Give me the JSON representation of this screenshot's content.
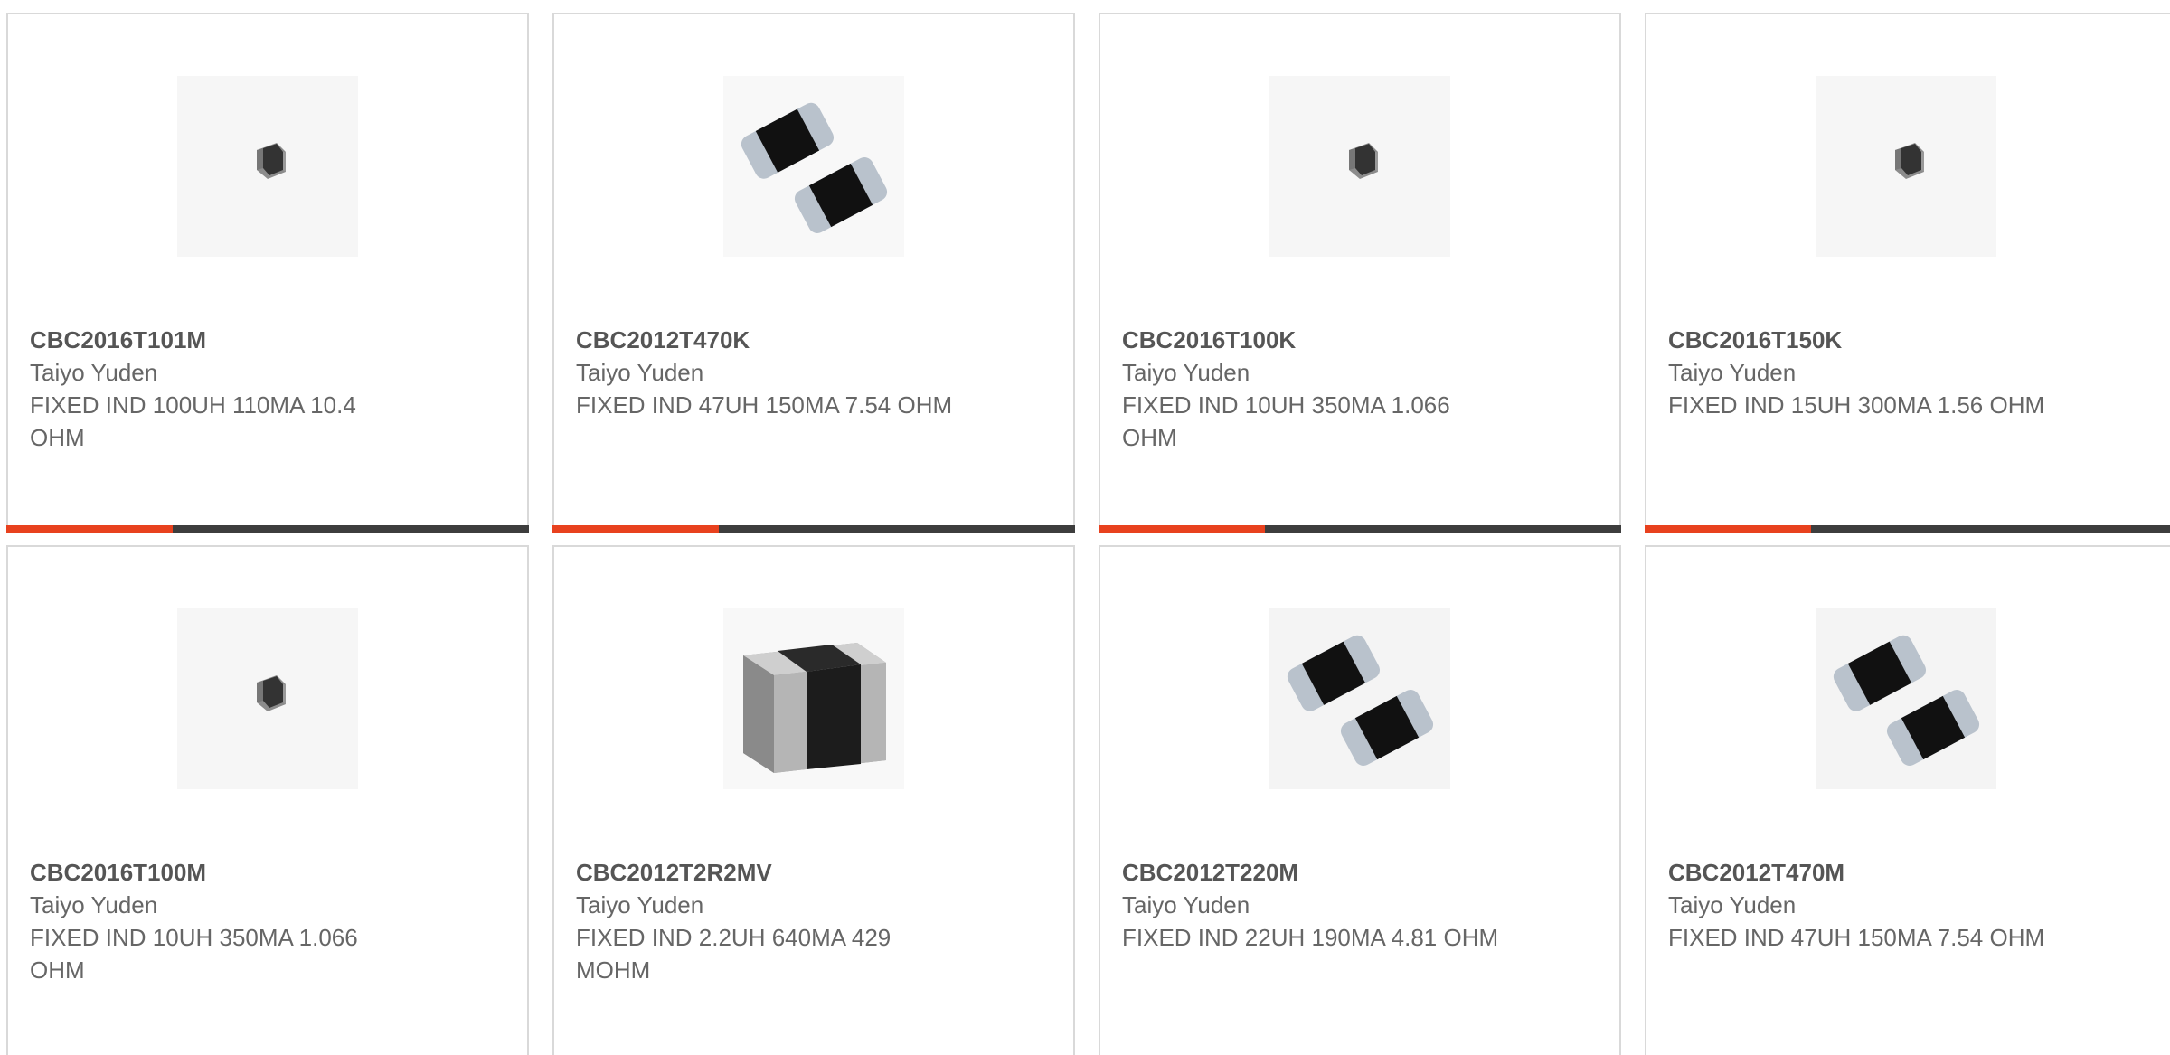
{
  "cards": [
    {
      "part_number": "CBC2016T101M",
      "manufacturer": "Taiyo Yuden",
      "description": "FIXED IND 100UH 110MA 10.4 OHM",
      "image": "small-inductor-icon"
    },
    {
      "part_number": "CBC2012T470K",
      "manufacturer": "Taiyo Yuden",
      "description": "FIXED IND 47UH 150MA 7.54 OHM",
      "image": "double-inductor-icon"
    },
    {
      "part_number": "CBC2016T100K",
      "manufacturer": "Taiyo Yuden",
      "description": "FIXED IND 10UH 350MA 1.066 OHM",
      "image": "small-inductor-icon"
    },
    {
      "part_number": "CBC2016T150K",
      "manufacturer": "Taiyo Yuden",
      "description": "FIXED IND 15UH 300MA 1.56 OHM",
      "image": "small-inductor-icon"
    },
    {
      "part_number": "CBC2016T100M",
      "manufacturer": "Taiyo Yuden",
      "description": "FIXED IND 10UH 350MA 1.066 OHM",
      "image": "small-inductor-icon"
    },
    {
      "part_number": "CBC2012T2R2MV",
      "manufacturer": "Taiyo Yuden",
      "description": "FIXED IND 2.2UH 640MA 429 MOHM",
      "image": "large-inductor-icon"
    },
    {
      "part_number": "CBC2012T220M",
      "manufacturer": "Taiyo Yuden",
      "description": "FIXED IND 22UH 190MA 4.81 OHM",
      "image": "double-inductor-icon"
    },
    {
      "part_number": "CBC2012T470M",
      "manufacturer": "Taiyo Yuden",
      "description": "FIXED IND 47UH 150MA 7.54 OHM",
      "image": "double-inductor-icon"
    }
  ],
  "colors": {
    "accent": "#e8411e",
    "bar_dark": "#3d3d3d",
    "border": "#d9d9d9",
    "text": "#666666"
  }
}
